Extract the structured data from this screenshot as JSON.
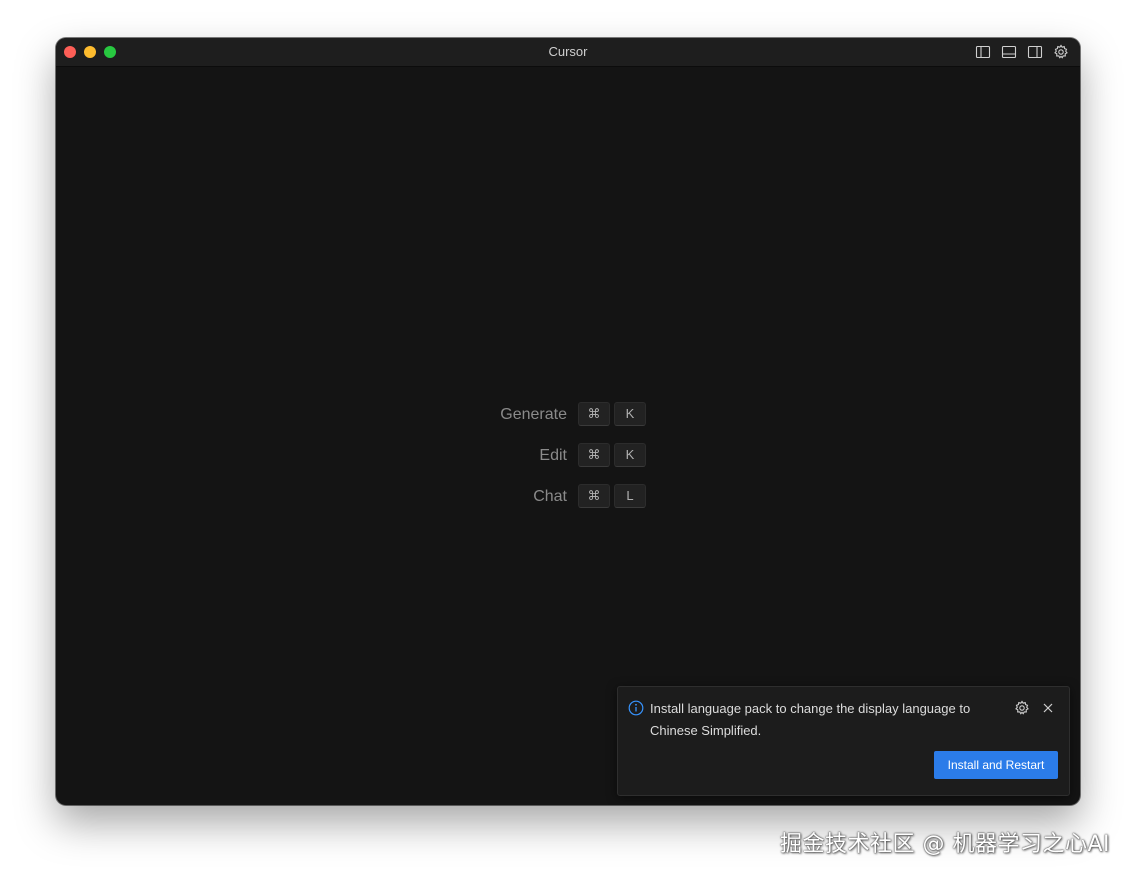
{
  "window": {
    "title": "Cursor"
  },
  "shortcuts": [
    {
      "label": "Generate",
      "keys": [
        "⌘",
        "K"
      ]
    },
    {
      "label": "Edit",
      "keys": [
        "⌘",
        "K"
      ]
    },
    {
      "label": "Chat",
      "keys": [
        "⌘",
        "L"
      ]
    }
  ],
  "notification": {
    "message": "Install language pack to change the display language to Chinese Simplified.",
    "button_label": "Install and Restart"
  },
  "watermark": "掘金技术社区 @ 机器学习之心AI",
  "colors": {
    "editor_bg": "#141414",
    "accent": "#2b7ce9",
    "info": "#3794ff"
  }
}
